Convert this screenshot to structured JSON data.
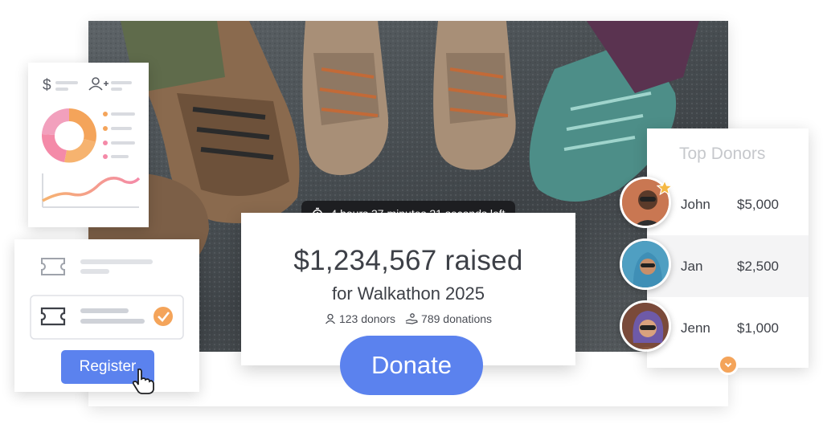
{
  "colors": {
    "accent": "#5b82ee",
    "orange": "#f4a45a",
    "pink": "#f48aa8",
    "dark": "#1e1f22",
    "text": "#3d4047"
  },
  "timer": {
    "icon": "stopwatch-icon",
    "text": "4 hours 37 minutes 21 seconds left"
  },
  "campaign": {
    "raised": "$1,234,567 raised",
    "subtitle": "for Walkathon 2025",
    "donors_count": "123 donors",
    "donations_count": "789 donations",
    "donate_label": "Donate"
  },
  "register": {
    "button_label": "Register"
  },
  "top_donors": {
    "title": "Top Donors",
    "items": [
      {
        "name": "John",
        "amount": "$5,000"
      },
      {
        "name": "Jan",
        "amount": "$2,500"
      },
      {
        "name": "Jenn",
        "amount": "$1,000"
      }
    ]
  }
}
